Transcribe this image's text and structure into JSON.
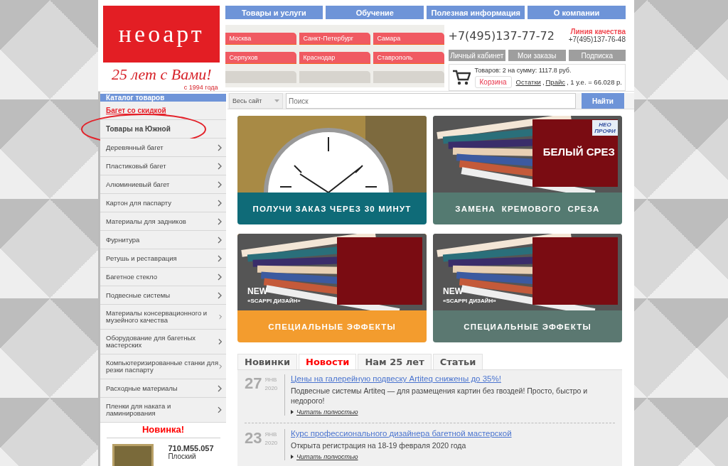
{
  "logo": {
    "brand": "неоарт",
    "tagline": "25 лет с Вами!",
    "since": "с 1994 года"
  },
  "nav": [
    "Товары и услуги",
    "Обучение",
    "Полезная информация",
    "О компании"
  ],
  "cities": [
    "Москва",
    "Санкт-Петербург",
    "Самара",
    "Серпухов",
    "Краснодар",
    "Ставрополь"
  ],
  "contact": {
    "phone": "+7(495)137-77-72",
    "quality_label": "Линия качества",
    "quality_phone": "+7(495)137-76-48"
  },
  "account_buttons": [
    "Личный кабинет",
    "Мои заказы",
    "Подписка"
  ],
  "cart": {
    "summary": "Товаров: 2 на сумму: 1117.8 руб.",
    "button": "Корзина",
    "links": [
      "Остатки",
      "Прайс"
    ],
    "separator": ",",
    "rate": ", 1 у.е. = 66.028 р."
  },
  "sidebar": {
    "title": "Каталог товаров",
    "items": [
      {
        "label": "Багет со скидкой",
        "kind": "sale",
        "circled": false
      },
      {
        "label": "Товары на Южной",
        "kind": "bold",
        "circled": true
      },
      {
        "label": "Деревянный багет",
        "kind": "category",
        "circled": false
      },
      {
        "label": "Пластиковый багет",
        "kind": "category",
        "circled": false
      },
      {
        "label": "Алюминиевый багет",
        "kind": "category",
        "circled": false
      },
      {
        "label": "Картон для паспарту",
        "kind": "category",
        "circled": false
      },
      {
        "label": "Материалы для задников",
        "kind": "category",
        "circled": false
      },
      {
        "label": "Фурнитура",
        "kind": "category",
        "circled": false
      },
      {
        "label": "Ретушь и реставрация",
        "kind": "category",
        "circled": false
      },
      {
        "label": "Багетное стекло",
        "kind": "category",
        "circled": false
      },
      {
        "label": "Подвесные системы",
        "kind": "category",
        "circled": false
      },
      {
        "label": "Материалы консервационного и музейного качества",
        "kind": "category",
        "circled": false
      },
      {
        "label": "Оборудование для багетных мастерских",
        "kind": "category",
        "circled": false
      },
      {
        "label": "Компьютеризированные станки для резки паспарту",
        "kind": "category",
        "circled": false
      },
      {
        "label": "Расходные материалы",
        "kind": "category",
        "circled": false
      },
      {
        "label": "Пленки для наката и ламинирования",
        "kind": "category",
        "circled": false
      }
    ]
  },
  "new_product": {
    "title": "Новинка!",
    "code": "710.M55.057",
    "name": "Плоский"
  },
  "search": {
    "scope": "Весь сайт",
    "placeholder": "Поиск",
    "button": "Найти"
  },
  "banners": [
    {
      "caption": "ПОЛУЧИ ЗАКАЗ ЧЕРЕЗ 30 МИНУТ",
      "color": "#0f6b78",
      "kind": "clock"
    },
    {
      "caption": "ЗАМЕНА  КРЕМОВОГО  СРЕЗА",
      "color": "#547a71",
      "kind": "cards",
      "overlay": "БЕЛЫЙ СРЕЗ",
      "logo": "НЕО ПРОФИ"
    },
    {
      "caption": "СПЕЦИАЛЬНЫЕ ЭФФЕКТЫ",
      "color": "#f39c2e",
      "kind": "cards",
      "badge": "NEW",
      "subtitle": "«SCAPPI ДИЗАЙН»"
    },
    {
      "caption": "СПЕЦИАЛЬНЫЕ ЭФФЕКТЫ",
      "color": "#5b7871",
      "kind": "cards",
      "badge": "NEW",
      "subtitle": "«SCAPPI ДИЗАЙН»"
    }
  ],
  "tabs": [
    {
      "label": "Новинки",
      "selected": false
    },
    {
      "label": "Новости",
      "selected": true
    },
    {
      "label": "Нам 25 лет",
      "selected": false
    },
    {
      "label": "Статьи",
      "selected": false
    }
  ],
  "news": [
    {
      "day": "27",
      "month": "ЯНВ",
      "year": "2020",
      "title": "Цены на галерейную подвеску Artiteq снижены до 35%!",
      "text": "Подвесные системы Artiteq — для размещения картин без гвоздей! Просто, быстро и недорого!",
      "more": "Читать полностью"
    },
    {
      "day": "23",
      "month": "ЯНВ",
      "year": "2020",
      "title": "Курс профессионального дизайнера багетной мастерской",
      "text": "Открыта регистрация на 18-19 февраля 2020 года",
      "more": "Читать полностью"
    }
  ]
}
